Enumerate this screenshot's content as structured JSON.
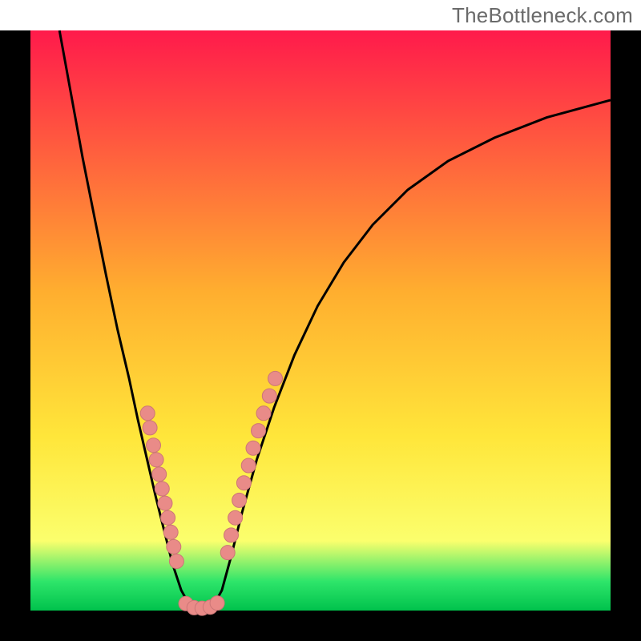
{
  "watermark": "TheBottleneck.com",
  "colors": {
    "frame": "#000000",
    "curve": "#000000",
    "dot_fill": "#e98b88",
    "dot_stroke": "#cc7676",
    "grad_top": "#ff1a4b",
    "grad_mid1": "#ffae2f",
    "grad_mid2": "#ffe63a",
    "grad_band": "#fbff6d",
    "grad_green": "#2ee56a",
    "grad_bottom": "#00c24c"
  },
  "chart_data": {
    "type": "line",
    "title": "",
    "xlabel": "",
    "ylabel": "",
    "xlim": [
      0,
      100
    ],
    "ylim": [
      0,
      100
    ],
    "curve": [
      {
        "x": 5.0,
        "y": 100.0
      },
      {
        "x": 7.0,
        "y": 89.0
      },
      {
        "x": 9.0,
        "y": 78.0
      },
      {
        "x": 11.0,
        "y": 68.0
      },
      {
        "x": 13.0,
        "y": 58.0
      },
      {
        "x": 15.0,
        "y": 48.5
      },
      {
        "x": 17.0,
        "y": 40.0
      },
      {
        "x": 18.5,
        "y": 33.0
      },
      {
        "x": 20.0,
        "y": 26.5
      },
      {
        "x": 21.5,
        "y": 20.0
      },
      {
        "x": 23.0,
        "y": 14.0
      },
      {
        "x": 24.5,
        "y": 8.0
      },
      {
        "x": 26.0,
        "y": 3.5
      },
      {
        "x": 27.5,
        "y": 0.8
      },
      {
        "x": 29.5,
        "y": 0.3
      },
      {
        "x": 31.5,
        "y": 0.8
      },
      {
        "x": 33.0,
        "y": 3.5
      },
      {
        "x": 34.5,
        "y": 9.0
      },
      {
        "x": 36.5,
        "y": 17.0
      },
      {
        "x": 39.0,
        "y": 26.0
      },
      {
        "x": 42.0,
        "y": 35.0
      },
      {
        "x": 45.5,
        "y": 44.0
      },
      {
        "x": 49.5,
        "y": 52.5
      },
      {
        "x": 54.0,
        "y": 60.0
      },
      {
        "x": 59.0,
        "y": 66.5
      },
      {
        "x": 65.0,
        "y": 72.5
      },
      {
        "x": 72.0,
        "y": 77.5
      },
      {
        "x": 80.0,
        "y": 81.5
      },
      {
        "x": 89.0,
        "y": 85.0
      },
      {
        "x": 100.0,
        "y": 88.0
      }
    ],
    "dots": [
      {
        "x": 20.2,
        "y": 34.0
      },
      {
        "x": 20.6,
        "y": 31.5
      },
      {
        "x": 21.2,
        "y": 28.5
      },
      {
        "x": 21.7,
        "y": 26.0
      },
      {
        "x": 22.2,
        "y": 23.5
      },
      {
        "x": 22.7,
        "y": 21.0
      },
      {
        "x": 23.2,
        "y": 18.5
      },
      {
        "x": 23.7,
        "y": 16.0
      },
      {
        "x": 24.2,
        "y": 13.5
      },
      {
        "x": 24.7,
        "y": 11.0
      },
      {
        "x": 25.2,
        "y": 8.5
      },
      {
        "x": 26.8,
        "y": 1.2
      },
      {
        "x": 28.2,
        "y": 0.5
      },
      {
        "x": 29.6,
        "y": 0.4
      },
      {
        "x": 31.0,
        "y": 0.6
      },
      {
        "x": 32.2,
        "y": 1.3
      },
      {
        "x": 34.0,
        "y": 10.0
      },
      {
        "x": 34.6,
        "y": 13.0
      },
      {
        "x": 35.3,
        "y": 16.0
      },
      {
        "x": 36.0,
        "y": 19.0
      },
      {
        "x": 36.8,
        "y": 22.0
      },
      {
        "x": 37.6,
        "y": 25.0
      },
      {
        "x": 38.4,
        "y": 28.0
      },
      {
        "x": 39.3,
        "y": 31.0
      },
      {
        "x": 40.2,
        "y": 34.0
      },
      {
        "x": 41.2,
        "y": 37.0
      },
      {
        "x": 42.2,
        "y": 40.0
      }
    ]
  }
}
